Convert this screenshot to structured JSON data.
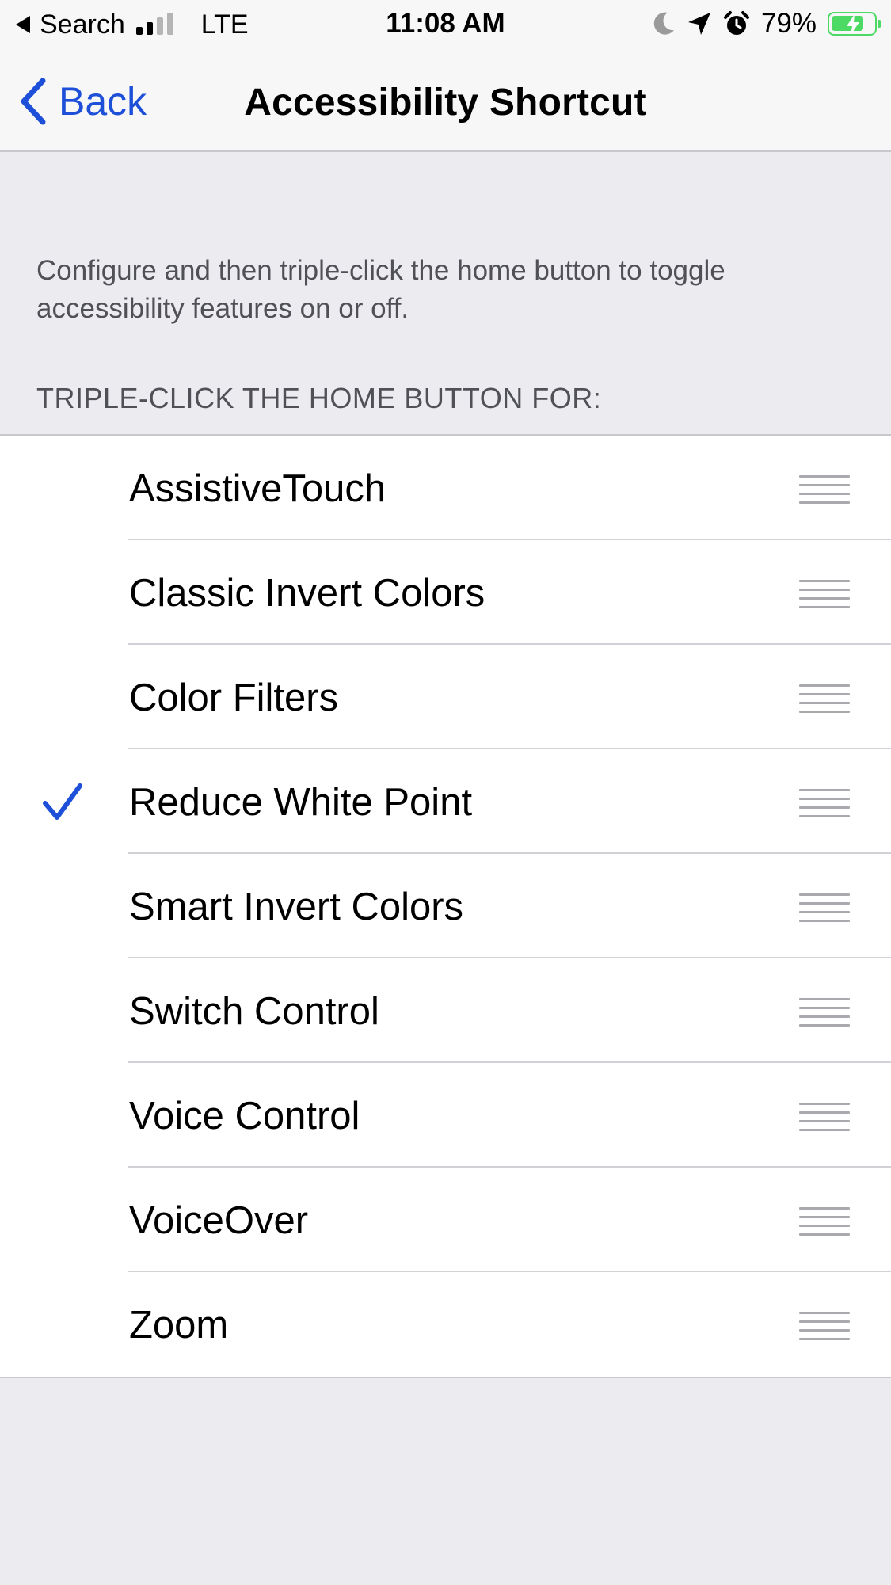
{
  "status_bar": {
    "back_app": "Search",
    "network": "LTE",
    "time": "11:08 AM",
    "battery_percent": "79%",
    "battery_level": 0.79,
    "signal_bars_filled": 2,
    "signal_bars_total": 4,
    "icons": [
      "back-arrow-icon",
      "signal-icon",
      "moon-icon",
      "location-icon",
      "alarm-icon",
      "battery-charging-icon"
    ]
  },
  "nav": {
    "back_label": "Back",
    "title": "Accessibility Shortcut"
  },
  "description": "Configure and then triple-click the home button to toggle accessibility features on or off.",
  "section_header": "TRIPLE-CLICK THE HOME BUTTON FOR:",
  "shortcut_list": {
    "items": [
      {
        "label": "AssistiveTouch",
        "checked": false
      },
      {
        "label": "Classic Invert Colors",
        "checked": false
      },
      {
        "label": "Color Filters",
        "checked": false
      },
      {
        "label": "Reduce White Point",
        "checked": true
      },
      {
        "label": "Smart Invert Colors",
        "checked": false
      },
      {
        "label": "Switch Control",
        "checked": false
      },
      {
        "label": "Voice Control",
        "checked": false
      },
      {
        "label": "VoiceOver",
        "checked": false
      },
      {
        "label": "Zoom",
        "checked": false
      }
    ]
  },
  "colors": {
    "accent": "#1e4fd8",
    "battery": "#4cd964",
    "background": "#ebebf0",
    "secondary_text": "#505057"
  }
}
